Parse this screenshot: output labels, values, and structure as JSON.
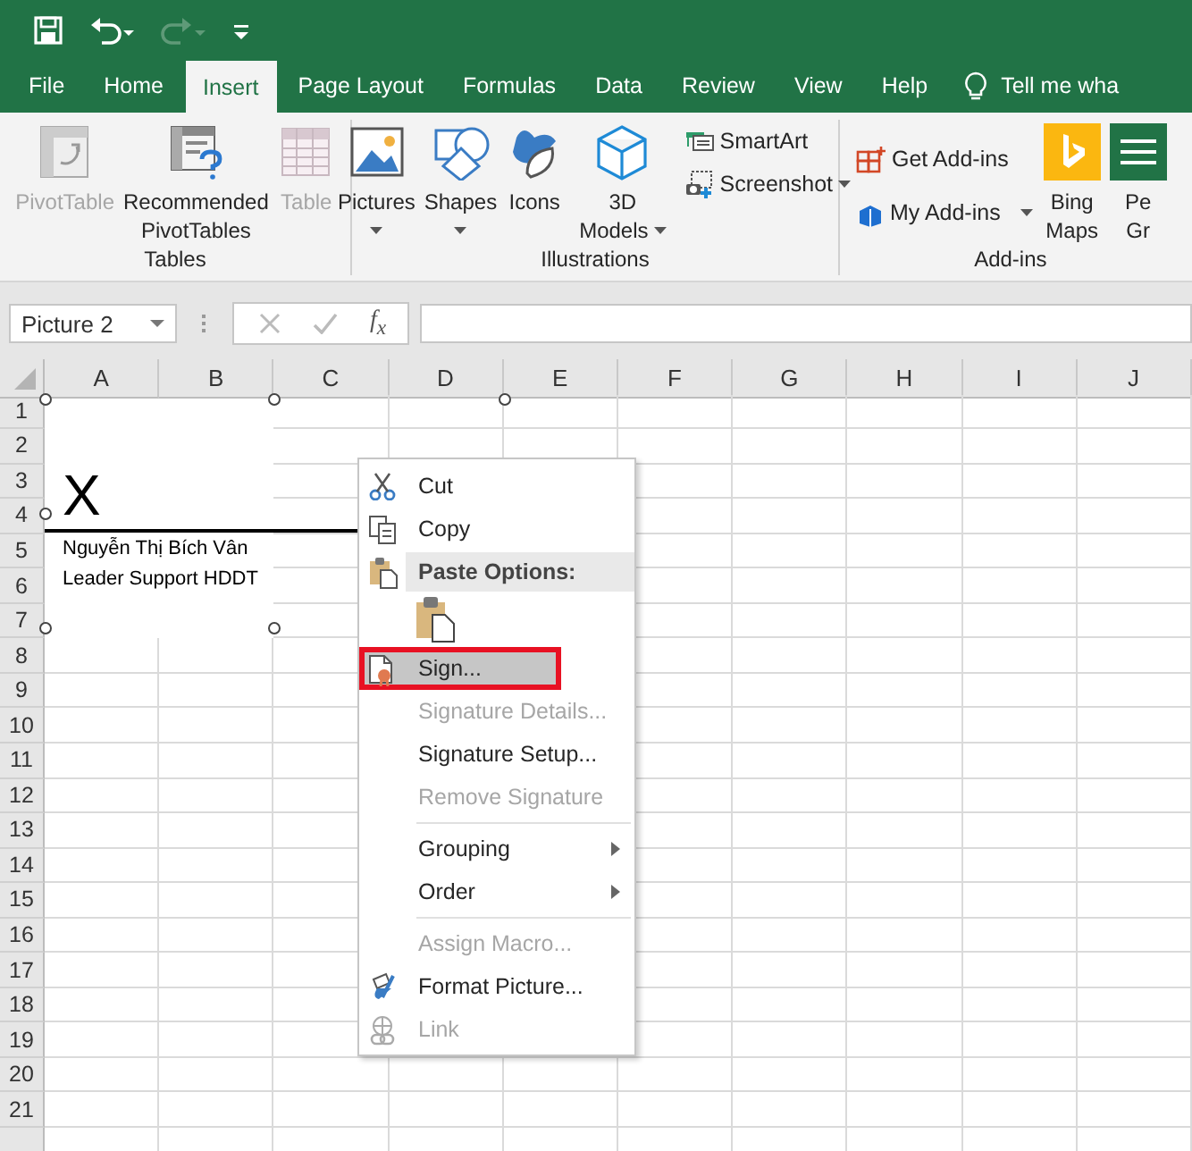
{
  "quick_access": {
    "undo_dropdown": true,
    "redo_disabled": true
  },
  "tabs": [
    {
      "label": "File",
      "selected": false
    },
    {
      "label": "Home",
      "selected": false
    },
    {
      "label": "Insert",
      "selected": true
    },
    {
      "label": "Page Layout",
      "selected": false
    },
    {
      "label": "Formulas",
      "selected": false
    },
    {
      "label": "Data",
      "selected": false
    },
    {
      "label": "Review",
      "selected": false
    },
    {
      "label": "View",
      "selected": false
    },
    {
      "label": "Help",
      "selected": false
    }
  ],
  "tell_me": "Tell me wha",
  "ribbon": {
    "groups": [
      {
        "label": "Tables",
        "commands": [
          {
            "kind": "large",
            "lines": [
              "PivotTable"
            ],
            "disabled": true,
            "dropdown": false
          },
          {
            "kind": "large",
            "lines": [
              "Recommended",
              "PivotTables"
            ],
            "disabled": false,
            "dropdown": false
          },
          {
            "kind": "large",
            "lines": [
              "Table"
            ],
            "disabled": true,
            "dropdown": false
          }
        ]
      },
      {
        "label": "Illustrations",
        "commands": [
          {
            "kind": "large",
            "lines": [
              "Pictures"
            ],
            "disabled": false,
            "dropdown": true
          },
          {
            "kind": "large",
            "lines": [
              "Shapes"
            ],
            "disabled": false,
            "dropdown": true
          },
          {
            "kind": "large",
            "lines": [
              "Icons"
            ],
            "disabled": false,
            "dropdown": false
          },
          {
            "kind": "large",
            "lines": [
              "3D",
              "Models"
            ],
            "disabled": false,
            "dropdown": true
          },
          {
            "kind": "small",
            "lines": [
              "SmartArt",
              "Screenshot"
            ],
            "carets": [
              false,
              true
            ]
          }
        ]
      },
      {
        "label": "Add-ins",
        "commands": [
          {
            "kind": "small",
            "lines": [
              "Get Add-ins",
              "My Add-ins"
            ],
            "carets": [
              false,
              true
            ]
          },
          {
            "kind": "large",
            "lines": [
              "Bing",
              "Maps"
            ],
            "disabled": false,
            "dropdown": false
          },
          {
            "kind": "large",
            "lines": [
              "Pe",
              "Gr"
            ],
            "disabled": false,
            "dropdown": false
          }
        ]
      }
    ]
  },
  "name_box": "Picture 2",
  "fx_label": "f$_{x}$",
  "columns": [
    "A",
    "B",
    "C",
    "D",
    "E",
    "F",
    "G",
    "H",
    "I",
    "J"
  ],
  "rows": [
    "1",
    "2",
    "3",
    "4",
    "5",
    "6",
    "7",
    "8",
    "9",
    "10",
    "11",
    "12",
    "13",
    "14",
    "15",
    "16",
    "17",
    "18",
    "19",
    "20",
    "21"
  ],
  "picture": {
    "mark": "X",
    "signer_name": "Nguyễn Thị Bích Vân",
    "signer_title": "Leader Support HDDT"
  },
  "context_menu": [
    {
      "kind": "item",
      "label": "Cut",
      "disabled": false,
      "selected": false,
      "submenu": false,
      "outlined": false
    },
    {
      "kind": "item",
      "label": "Copy",
      "disabled": false,
      "selected": false,
      "submenu": false,
      "outlined": false
    },
    {
      "kind": "header",
      "label": "Paste Options:"
    },
    {
      "kind": "paste_icons"
    },
    {
      "kind": "item",
      "label": "Sign...",
      "disabled": false,
      "selected": true,
      "submenu": false,
      "outlined": true
    },
    {
      "kind": "item",
      "label": "Signature Details...",
      "disabled": true,
      "selected": false,
      "submenu": false,
      "outlined": false
    },
    {
      "kind": "item",
      "label": "Signature Setup...",
      "disabled": false,
      "selected": false,
      "submenu": false,
      "outlined": false
    },
    {
      "kind": "item",
      "label": "Remove Signature",
      "disabled": true,
      "selected": false,
      "submenu": false,
      "outlined": false
    },
    {
      "kind": "separator"
    },
    {
      "kind": "item",
      "label": "Grouping",
      "disabled": false,
      "selected": false,
      "submenu": true,
      "outlined": false
    },
    {
      "kind": "item",
      "label": "Order",
      "disabled": false,
      "selected": false,
      "submenu": true,
      "outlined": false
    },
    {
      "kind": "separator"
    },
    {
      "kind": "item",
      "label": "Assign Macro...",
      "disabled": true,
      "selected": false,
      "submenu": false,
      "outlined": false
    },
    {
      "kind": "item",
      "label": "Format Picture...",
      "disabled": false,
      "selected": false,
      "submenu": false,
      "outlined": false
    },
    {
      "kind": "item",
      "label": "Link",
      "disabled": true,
      "selected": false,
      "submenu": false,
      "outlined": false
    }
  ]
}
